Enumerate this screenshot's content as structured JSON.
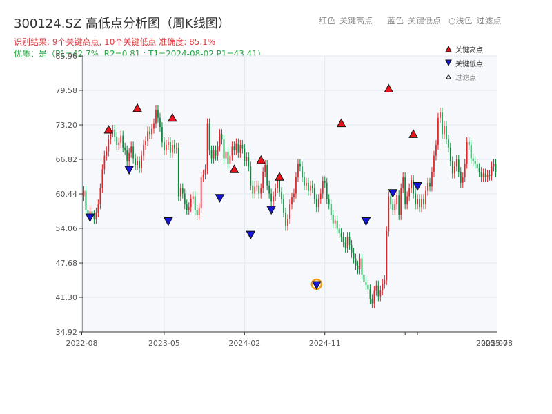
{
  "title": "300124.SZ 高低点分析图（周K线图）",
  "subtitle_result": "识别结果: 9个关键高点, 10个关键低点   准确度: 85.1%",
  "subtitle_quality": "优质：是（P1=42.7%, R2=0.81 ; T1=2024-08-02 P1=43.41）",
  "top_legend": {
    "red": "红色–关键高点",
    "blue": "蓝色–关键低点",
    "light": "浅色–过滤点"
  },
  "colors": {
    "up": "#e0262b",
    "down": "#0b8a3c",
    "high_marker": "#e8141c",
    "low_marker": "#1616d8",
    "highlight_ring": "#f39c12",
    "plot_bg": "#f6f8fb"
  },
  "chart_data": {
    "type": "candlestick",
    "x_ticks": [
      "2022-08",
      "2023-05",
      "2024-02",
      "2024-11",
      "2025-07",
      "2025-08"
    ],
    "y_ticks": [
      34.92,
      41.3,
      47.68,
      54.06,
      60.44,
      66.82,
      73.2,
      79.58,
      85.96
    ],
    "ylim": [
      34.92,
      85.96
    ],
    "grid": true,
    "legend": {
      "position": "top-right",
      "entries": [
        "关键高点",
        "关键低点",
        "过滤点"
      ]
    },
    "weekly_close": [
      61.0,
      57.5,
      56.8,
      57.2,
      56.5,
      55.8,
      57.0,
      58.5,
      61.5,
      65.0,
      67.5,
      68.3,
      70.5,
      71.8,
      72.3,
      71.0,
      69.5,
      69.9,
      71.2,
      69.0,
      68.5,
      66.5,
      68.0,
      69.2,
      67.0,
      65.8,
      66.5,
      65.2,
      67.5,
      69.5,
      70.2,
      72.0,
      71.5,
      72.5,
      73.5,
      76.0,
      74.5,
      72.8,
      70.0,
      68.5,
      69.5,
      70.0,
      68.0,
      69.5,
      68.8,
      69.0,
      60.0,
      61.5,
      60.5,
      58.5,
      57.5,
      58.0,
      59.5,
      60.0,
      57.5,
      56.5,
      57.8,
      63.5,
      64.0,
      65.0,
      73.5,
      68.5,
      67.0,
      68.5,
      67.5,
      69.2,
      71.5,
      70.5,
      67.0,
      68.2,
      66.0,
      67.5,
      69.2,
      68.5,
      69.8,
      68.0,
      69.5,
      68.8,
      66.5,
      67.2,
      65.5,
      62.0,
      60.5,
      61.8,
      62.0,
      60.5,
      61.5,
      64.5,
      65.8,
      62.0,
      60.5,
      59.0,
      60.0,
      61.5,
      63.0,
      60.8,
      59.5,
      57.0,
      54.5,
      55.8,
      58.5,
      59.8,
      60.5,
      63.5,
      66.0,
      65.5,
      63.5,
      62.0,
      62.5,
      61.0,
      62.0,
      61.5,
      59.5,
      58.0,
      59.5,
      60.5,
      62.8,
      62.5,
      59.5,
      58.5,
      56.5,
      55.0,
      55.5,
      54.0,
      53.2,
      52.5,
      51.5,
      50.5,
      52.5,
      51.0,
      49.5,
      48.5,
      47.2,
      46.5,
      48.5,
      45.5,
      44.2,
      43.6,
      42.8,
      41.0,
      40.2,
      42.5,
      43.5,
      41.5,
      42.6,
      43.8,
      44.5,
      53.5,
      60.0,
      58.5,
      57.5,
      58.5,
      60.2,
      56.5,
      61.5,
      63.5,
      58.5,
      60.0,
      61.5,
      63.0,
      60.5,
      58.5,
      59.5,
      58.0,
      59.5,
      58.5,
      61.0,
      62.5,
      61.8,
      64.5,
      67.5,
      69.5,
      74.5,
      75.5,
      71.5,
      73.0,
      70.5,
      69.0,
      66.5,
      64.2,
      65.5,
      66.8,
      64.5,
      62.5,
      63.5,
      66.0,
      70.0,
      69.5,
      67.0,
      66.5,
      66.0,
      65.2,
      64.5,
      63.5,
      64.2,
      63.5,
      64.0,
      63.8,
      65.5,
      66.0,
      64.5
    ],
    "key_highs": [
      {
        "week": 12,
        "price": 72.3
      },
      {
        "week": 26,
        "price": 76.3
      },
      {
        "week": 43,
        "price": 74.5
      },
      {
        "week": 73,
        "price": 65.0
      },
      {
        "week": 86,
        "price": 66.7
      },
      {
        "week": 95,
        "price": 63.6
      },
      {
        "week": 125,
        "price": 73.5
      },
      {
        "week": 148,
        "price": 79.9
      },
      {
        "week": 160,
        "price": 71.5
      }
    ],
    "key_lows": [
      {
        "week": 3,
        "price": 56.1
      },
      {
        "week": 22,
        "price": 64.9
      },
      {
        "week": 41,
        "price": 55.4
      },
      {
        "week": 66,
        "price": 59.7
      },
      {
        "week": 81,
        "price": 52.9
      },
      {
        "week": 91,
        "price": 57.5
      },
      {
        "week": 113,
        "price": 43.6
      },
      {
        "week": 137,
        "price": 55.4
      },
      {
        "week": 150,
        "price": 60.6
      },
      {
        "week": 162,
        "price": 61.9
      }
    ],
    "highlighted_low_week": 113
  },
  "chart_legend_labels": {
    "high": "关键高点",
    "low": "关键低点",
    "filtered": "过滤点"
  }
}
